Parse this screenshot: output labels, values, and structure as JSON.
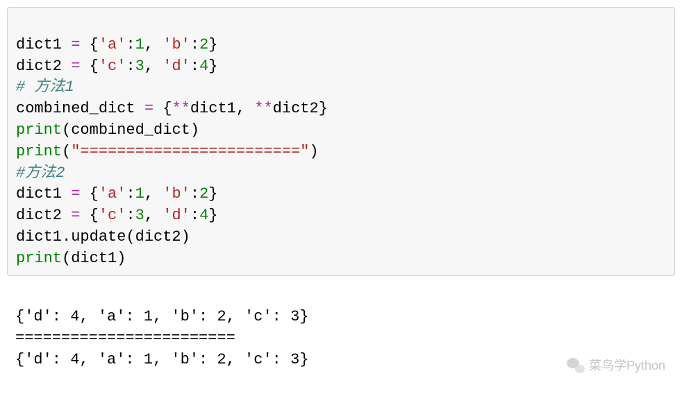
{
  "code": {
    "line1": {
      "pre": "dict1 ",
      "eq": "=",
      "sp": " {",
      "k1": "'a'",
      "c1": ":",
      "v1": "1",
      "cm1": ", ",
      "k2": "'b'",
      "c2": ":",
      "v2": "2",
      "end": "}"
    },
    "line2": {
      "pre": "dict2 ",
      "eq": "=",
      "sp": " {",
      "k1": "'c'",
      "c1": ":",
      "v1": "3",
      "cm1": ", ",
      "k2": "'d'",
      "c2": ":",
      "v2": "4",
      "end": "}"
    },
    "line3": "# 方法1",
    "line4": {
      "pre": "combined_dict ",
      "eq": "=",
      "sp": " {",
      "star1": "**",
      "d1": "dict1, ",
      "star2": "**",
      "d2": "dict2}"
    },
    "line5": {
      "fn": "print",
      "args": "(combined_dict)"
    },
    "line6": {
      "fn": "print",
      "open": "(",
      "str": "\"========================\"",
      "close": ")"
    },
    "line7": "#方法2",
    "line8": {
      "pre": "dict1 ",
      "eq": "=",
      "sp": " {",
      "k1": "'a'",
      "c1": ":",
      "v1": "1",
      "cm1": ", ",
      "k2": "'b'",
      "c2": ":",
      "v2": "2",
      "end": "}"
    },
    "line9": {
      "pre": "dict2 ",
      "eq": "=",
      "sp": " {",
      "k1": "'c'",
      "c1": ":",
      "v1": "3",
      "cm1": ", ",
      "k2": "'d'",
      "c2": ":",
      "v2": "4",
      "end": "}"
    },
    "line10": "dict1.update(dict2)",
    "line11": {
      "fn": "print",
      "args": "(dict1)"
    }
  },
  "output": {
    "line1": "{'d': 4, 'a': 1, 'b': 2, 'c': 3}",
    "line2": "========================",
    "line3": "{'d': 4, 'a': 1, 'b': 2, 'c': 3}"
  },
  "watermark": "菜鸟学Python"
}
